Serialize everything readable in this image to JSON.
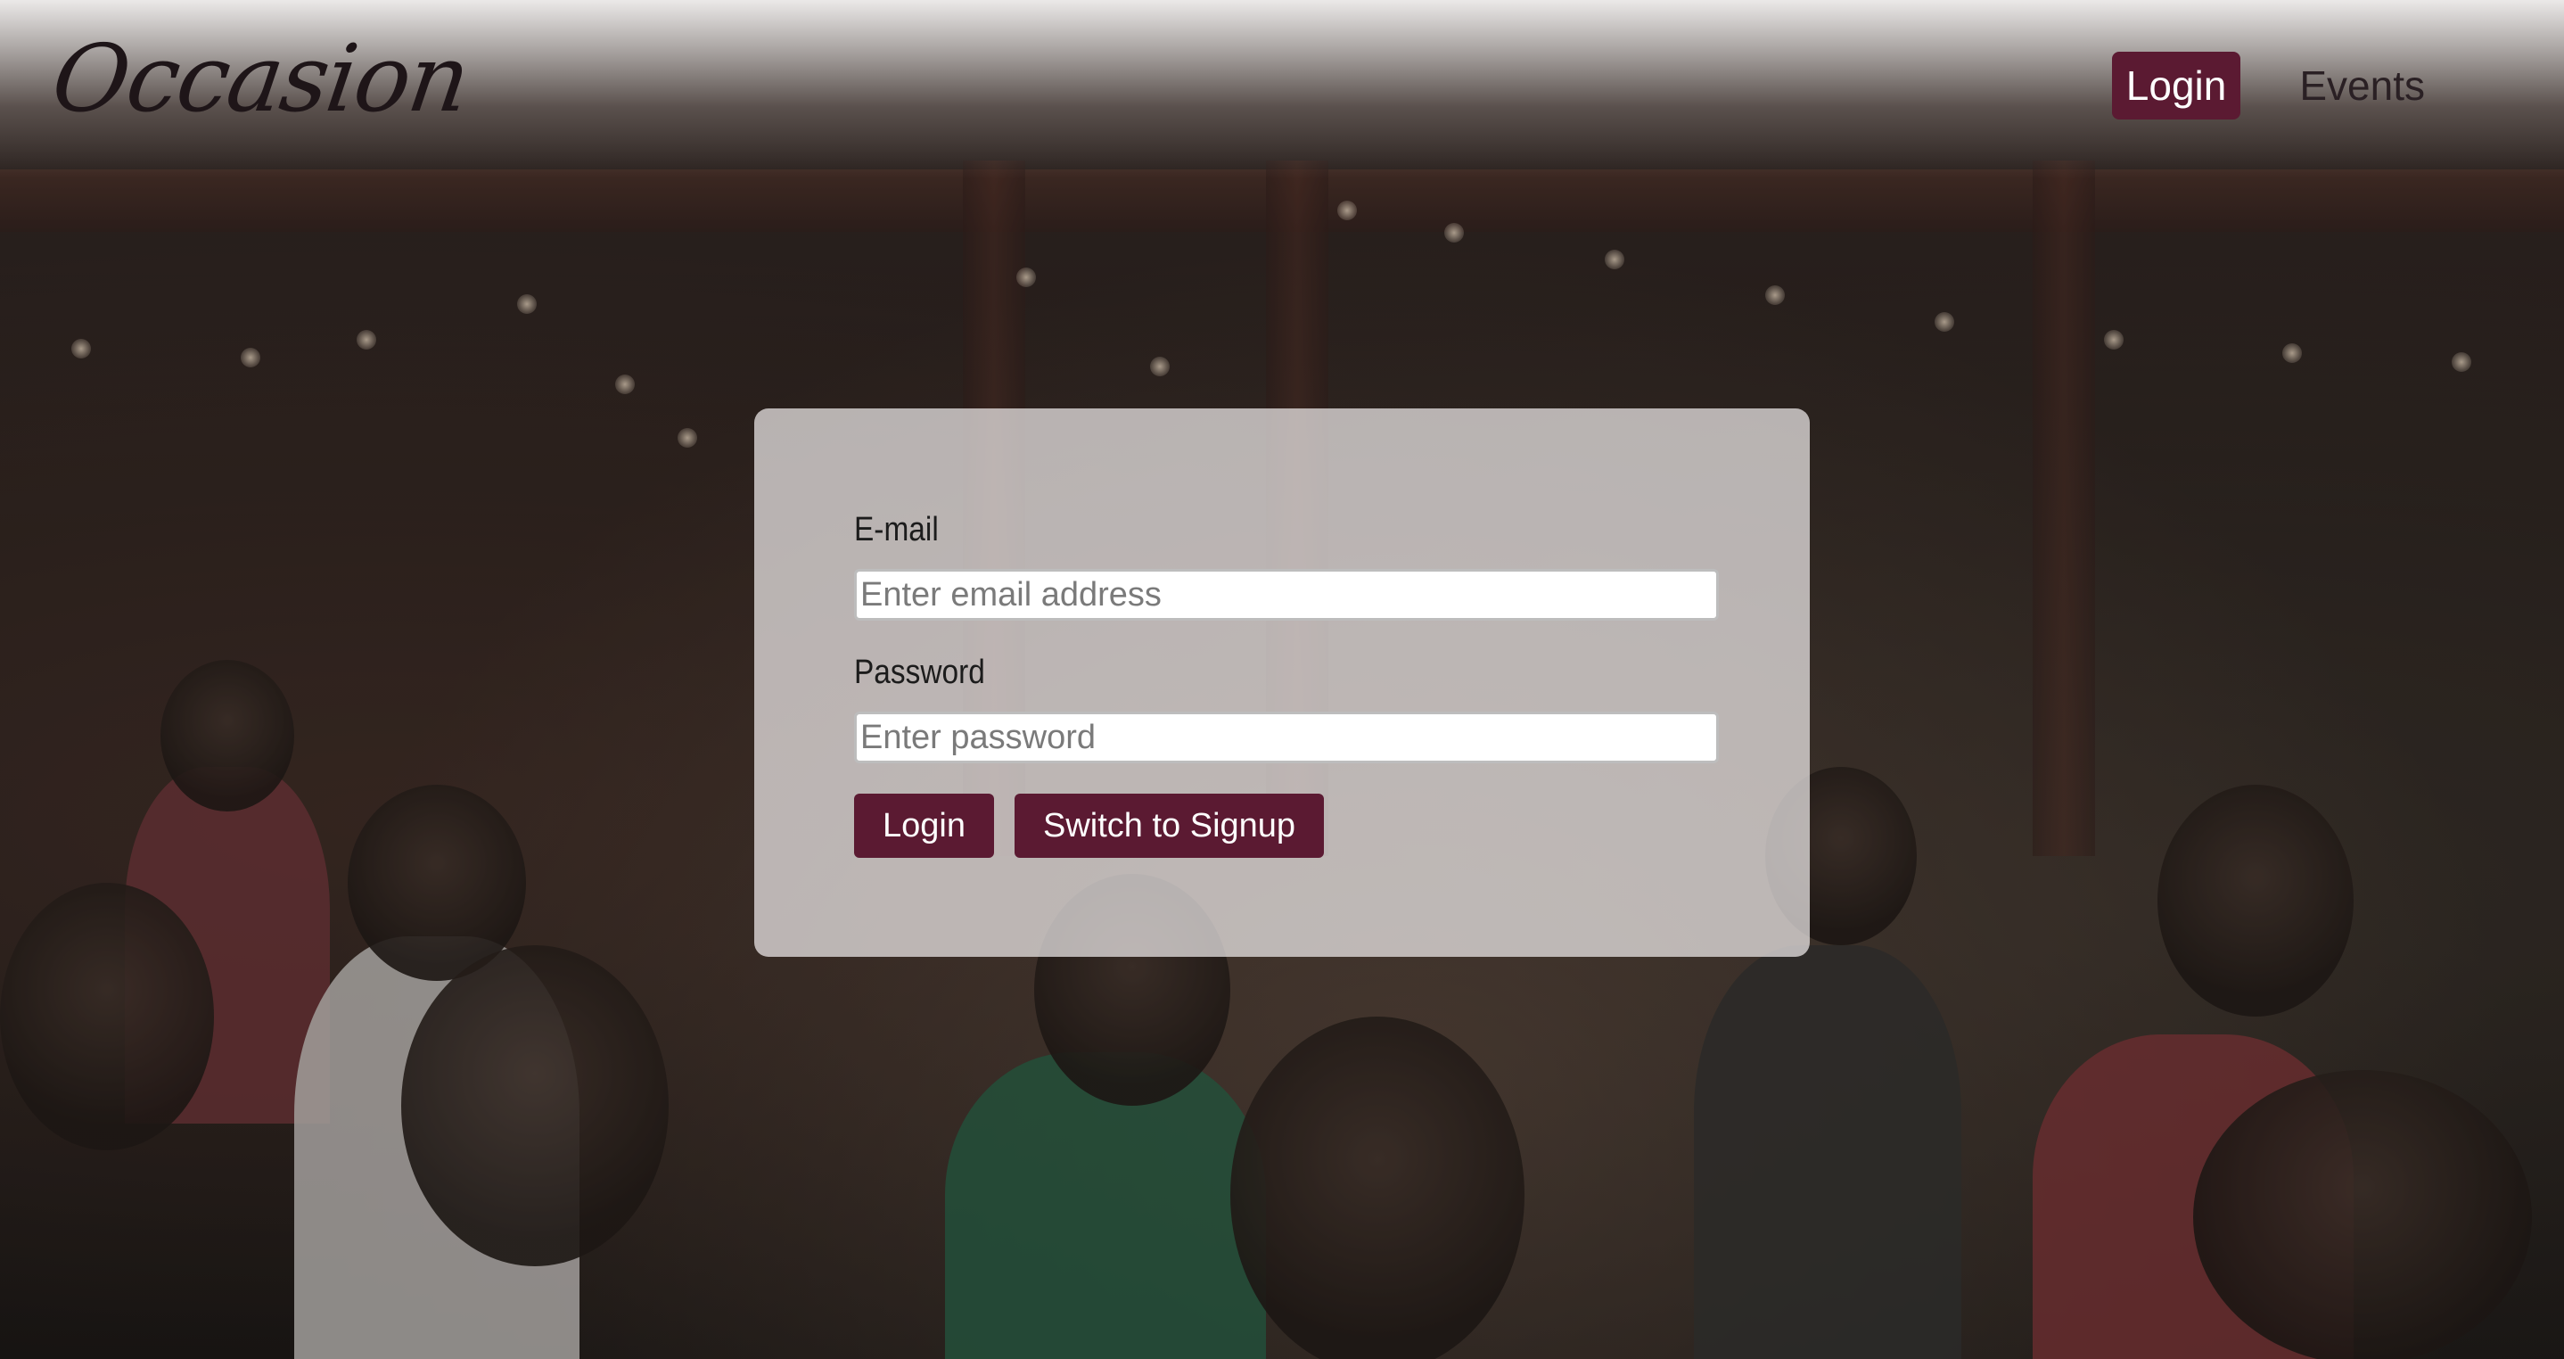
{
  "header": {
    "logo_text": "Occasion",
    "nav": {
      "login_label": "Login",
      "events_label": "Events"
    }
  },
  "login_form": {
    "email_label": "E-mail",
    "email_placeholder": "Enter email address",
    "email_value": "",
    "password_label": "Password",
    "password_placeholder": "Enter password",
    "password_value": "",
    "login_button_label": "Login",
    "switch_button_label": "Switch to Signup"
  },
  "colors": {
    "accent": "#5b1a32",
    "logo": "#1e1518"
  }
}
